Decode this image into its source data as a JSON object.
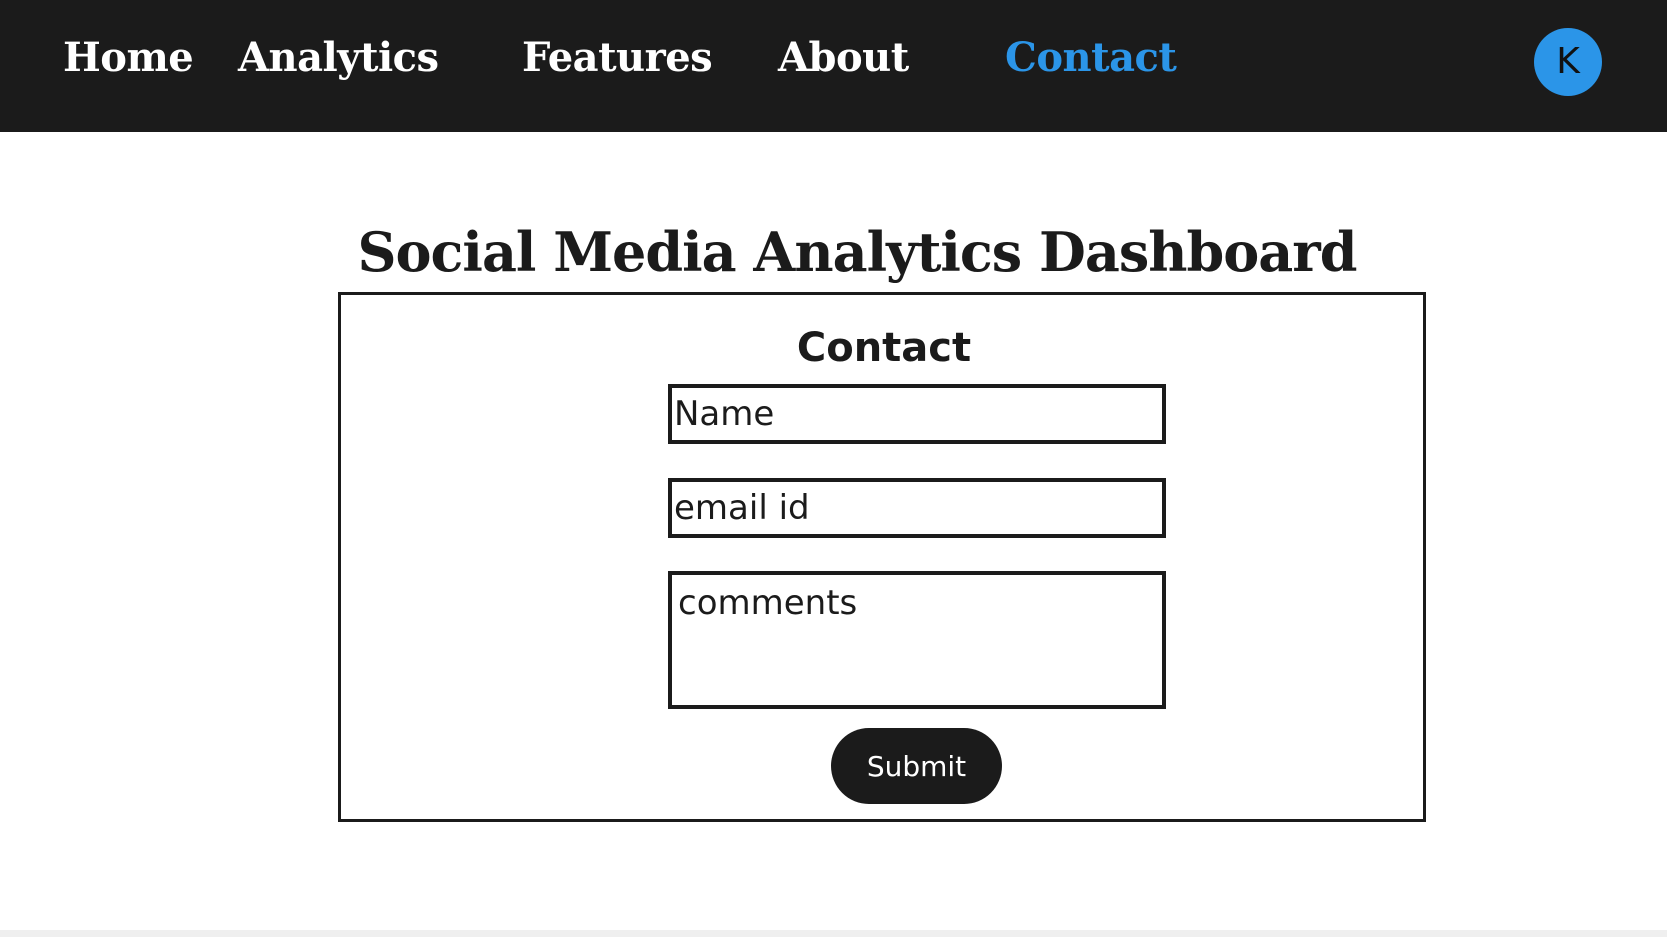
{
  "nav": {
    "items": [
      {
        "label": "Home"
      },
      {
        "label": "Analytics"
      },
      {
        "label": "Features"
      },
      {
        "label": "About"
      },
      {
        "label": "Contact",
        "active": true
      }
    ],
    "avatar_initial": "K"
  },
  "page": {
    "title": "Social Media Analytics Dashboard"
  },
  "contact_form": {
    "heading": "Contact",
    "name_placeholder": "Name",
    "email_placeholder": "email id",
    "comments_placeholder": "comments",
    "submit_label": "Submit"
  },
  "colors": {
    "navbar_bg": "#1b1b1b",
    "accent": "#2b95e8",
    "text": "#1b1b1b",
    "page_bg": "#ffffff"
  },
  "icons": {
    "avatar": "user-avatar-circle"
  }
}
